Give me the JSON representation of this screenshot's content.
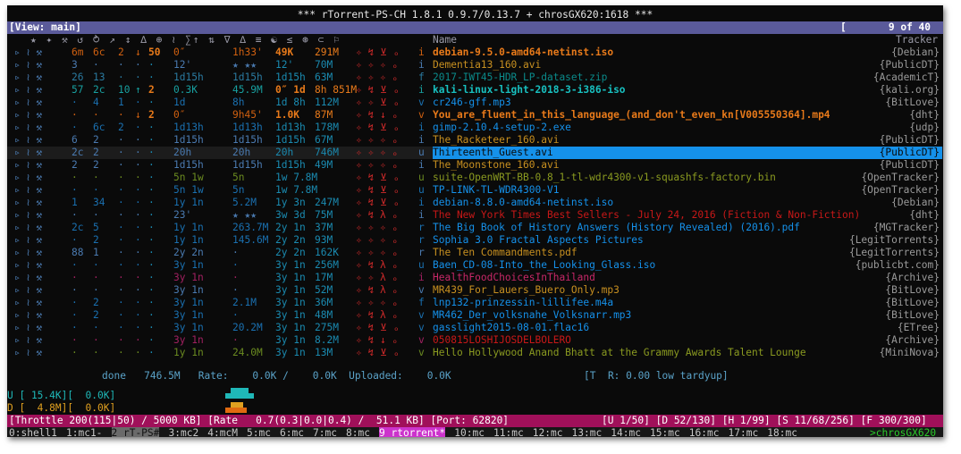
{
  "window_title": "*** rTorrent-PS-CH 1.8.1 0.9.7/0.13.7 + chrosGX620:1618 ***",
  "viewbar": {
    "left": "[View: main]",
    "right": "[       9 of 40   ]"
  },
  "columns": {
    "icons": "★ ✦ ⚒ ↺ ⥁ ↗ ↕ ∆ ⊕ ≀ ∑↑ ⇅ ∇ ∆ ≡ ☯ ≤ ⊛ ⊂ ⚐",
    "name": "Name",
    "tracker": "Tracker"
  },
  "rows": [
    {
      "flags": "▹ ≀ ⚒",
      "c1": "6m",
      "c2": "6c",
      "c3": "2",
      "c4": "↓",
      "c5": "50",
      "c6": "0″",
      "c7": "1h33'",
      "c8": "49K",
      "c9": "291M",
      "st": "✧ ↯ ⊻ ₒ",
      "k": "i",
      "name": "debian-9.5.0-amd64-netinst.iso",
      "tracker": "{Debian}",
      "ncolor": "#e87a1a",
      "bold": true,
      "rowcolor": "#d06010"
    },
    {
      "flags": "▹ ≀ ⚒",
      "c1": "3",
      "c2": "·",
      "c3": "·",
      "c4": "·",
      "c5": "·",
      "c6": "12'",
      "c7": "★ ★★",
      "c8": "12'",
      "c9": "70M",
      "st": "✧ ✧ ✧ ₒ",
      "k": "i",
      "name": "Dementia13_160.avi",
      "tracker": "{PublicDT}",
      "ncolor": "#c89020",
      "bold": false,
      "rowcolor": "#4a7ab0"
    },
    {
      "flags": "▹ ≀ ⚒",
      "c1": "26",
      "c2": "13",
      "c3": "·",
      "c4": "·",
      "c5": "·",
      "c6": "1d15h",
      "c7": "1d15h",
      "c8": "1d15h",
      "c9": "63M",
      "st": "✧ ✧ ✧ ₒ",
      "k": "f",
      "name": "2017-IWT45-HDR_LP-dataset.zip",
      "tracker": "{AcademicT}",
      "ncolor": "#0a8a8a",
      "bold": false,
      "rowcolor": "#2a7aa0"
    },
    {
      "flags": "▹ ≀ ⚒",
      "c1": "57",
      "c2": "2c",
      "c3": "10",
      "c4": "↑",
      "c5": "2",
      "c6": "0.3K",
      "c7": "45.9M",
      "c8": "0″ 1d",
      "c9": "8h 851M",
      "st": "✧ ↯ ⊻ ₒ",
      "k": "i",
      "name": "kali-linux-light-2018-3-i386-iso",
      "tracker": "{kali.org}",
      "ncolor": "#18c0c0",
      "bold": true,
      "rowcolor": "#18a0a0"
    },
    {
      "flags": "▹ ≀ ⚒",
      "c1": "·",
      "c2": "4",
      "c3": "1",
      "c4": "·",
      "c5": "·",
      "c6": "1d",
      "c7": "8h",
      "c8": "1d 8h",
      "c9": "112M",
      "st": "✧ ✧ ⊻ ₒ",
      "k": "v",
      "name": "cr246-gff.mp3",
      "tracker": "{BitLove}",
      "ncolor": "#1591ea",
      "bold": false,
      "rowcolor": "#1a70b0"
    },
    {
      "flags": "▹ ≀ ⚒",
      "c1": "·",
      "c2": "·",
      "c3": "·",
      "c4": "↓",
      "c5": "2",
      "c6": "0″",
      "c7": "9h45'",
      "c8": "1.0K",
      "c9": "87M",
      "st": "✧ ↯ ↓ ₒ",
      "k": "v",
      "name": "You_are_fluent_in_this_language_(and_don't_even_kn[V005550364].mp4",
      "tracker": "{dht}",
      "ncolor": "#e87a1a",
      "bold": true,
      "rowcolor": "#d06010"
    },
    {
      "flags": "▹ ≀ ⚒",
      "c1": "·",
      "c2": "6c",
      "c3": "2",
      "c4": "·",
      "c5": "·",
      "c6": "1d13h",
      "c7": "1d13h",
      "c8": "1d13h",
      "c9": "178M",
      "st": "✧ ↯ ⊻ ₒ",
      "k": "i",
      "name": "gimp-2.10.4-setup-2.exe",
      "tracker": "{udp}",
      "ncolor": "#1591ea",
      "bold": false,
      "rowcolor": "#1a70b0"
    },
    {
      "flags": "▹ ≀ ⚒",
      "c1": "6",
      "c2": "2",
      "c3": "·",
      "c4": "·",
      "c5": "·",
      "c6": "1d15h",
      "c7": "1d15h",
      "c8": "1d15h",
      "c9": "67M",
      "st": "✧ ✧ ✧ ₒ",
      "k": "i",
      "name": "The_Racketeer_160.avi",
      "tracker": "{PublicDT}",
      "ncolor": "#c89020",
      "bold": false,
      "rowcolor": "#4a7ab0"
    },
    {
      "flags": "▹ ≀ ⚒",
      "c1": "2c",
      "c2": "2",
      "c3": "·",
      "c4": "·",
      "c5": "·",
      "c6": "20h",
      "c7": "20h",
      "c8": "20h",
      "c9": "746M",
      "st": "✧ ✧ ✧ ₒ",
      "k": "u",
      "name": "Thirteenth_Guest.avi",
      "tracker": "{PublicDT}",
      "ncolor": "#0a0a0a",
      "bold": false,
      "rowcolor": "#4a7ab0",
      "selected": true
    },
    {
      "flags": "▹ ≀ ⚒",
      "c1": "2",
      "c2": "2",
      "c3": "·",
      "c4": "·",
      "c5": "·",
      "c6": "1d15h",
      "c7": "1d15h",
      "c8": "1d15h",
      "c9": "49M",
      "st": "✧ ✧ ✧ ₒ",
      "k": "i",
      "name": "The_Moonstone_160.avi",
      "tracker": "{PublicDT}",
      "ncolor": "#c89020",
      "bold": false,
      "rowcolor": "#4a7ab0"
    },
    {
      "flags": "▹ ≀ ⚒",
      "c1": "·",
      "c2": "·",
      "c3": "·",
      "c4": "·",
      "c5": "·",
      "c6": "5n 1w",
      "c7": "5n",
      "c8": "1w 7.8M",
      "c9": "",
      "st": "✧ ↯ ⊻ ₒ",
      "k": "u",
      "name": "suite-OpenWRT-BB-0.8_1-tl-wdr4300-v1-squashfs-factory.bin",
      "tracker": "{OpenTracker}",
      "ncolor": "#8a9a20",
      "bold": false,
      "rowcolor": "#6a8a20"
    },
    {
      "flags": "▹ ≀ ⚒",
      "c1": "·",
      "c2": "·",
      "c3": "·",
      "c4": "·",
      "c5": "·",
      "c6": "5n 1w",
      "c7": "5n",
      "c8": "1w 7.8M",
      "c9": "",
      "st": "✧ ↯ ⊻ ₒ",
      "k": "u",
      "name": "TP-LINK-TL-WDR4300-V1",
      "tracker": "{OpenTracker}",
      "ncolor": "#1591ea",
      "bold": false,
      "rowcolor": "#1a70b0"
    },
    {
      "flags": "▹ ≀ ⚒",
      "c1": "1",
      "c2": "34",
      "c3": "·",
      "c4": "·",
      "c5": "·",
      "c6": "1y 1n",
      "c7": "5.2M",
      "c8": "1y 3n",
      "c9": "247M",
      "st": "✧ ↯ ⊻ ₒ",
      "k": "i",
      "name": "debian-8.8.0-amd64-netinst.iso",
      "tracker": "{Debian}",
      "ncolor": "#1591ea",
      "bold": false,
      "rowcolor": "#1a70b0"
    },
    {
      "flags": "▹ ≀ ⚒",
      "c1": "·",
      "c2": "·",
      "c3": "·",
      "c4": "·",
      "c5": "·",
      "c6": "23'",
      "c7": "★ ★★",
      "c8": "3w 3d",
      "c9": "75M",
      "st": "✧ ↯ λ ₒ",
      "k": "i",
      "name": "The New York Times Best Sellers - July 24, 2016 (Fiction & Non-Fiction)",
      "tracker": "{dht}",
      "ncolor": "#c81818",
      "bold": false,
      "rowcolor": "#4a7ab0"
    },
    {
      "flags": "▹ ≀ ⚒",
      "c1": "2c",
      "c2": "5",
      "c3": "·",
      "c4": "·",
      "c5": "·",
      "c6": "1y 1n",
      "c7": "263.7M",
      "c8": "2y 1n",
      "c9": "37M",
      "st": "✧ ✧ ✧ ₒ",
      "k": "r",
      "name": "The Big Book of History Answers (History Revealed) (2016).pdf",
      "tracker": "{MGTracker}",
      "ncolor": "#1591ea",
      "bold": false,
      "rowcolor": "#1a70b0"
    },
    {
      "flags": "▹ ≀ ⚒",
      "c1": "·",
      "c2": "2",
      "c3": "·",
      "c4": "·",
      "c5": "·",
      "c6": "1y 1n",
      "c7": "145.6M",
      "c8": "2y 2n",
      "c9": "93M",
      "st": "✧ ✧ ✧ ₒ",
      "k": "r",
      "name": "Sophia 3.0 Fractal Aspects Pictures",
      "tracker": "{LegitTorrents}",
      "ncolor": "#1591ea",
      "bold": false,
      "rowcolor": "#1a70b0"
    },
    {
      "flags": "▹ ≀ ⚒",
      "c1": "88",
      "c2": "1",
      "c3": "·",
      "c4": "·",
      "c5": "·",
      "c6": "2y 2n",
      "c7": "·",
      "c8": "2y 2n",
      "c9": "162K",
      "st": "✧ ✧ ✧ ₒ",
      "k": "r",
      "name": "The Ten Commandments.pdf",
      "tracker": "{LegitTorrents}",
      "ncolor": "#c89020",
      "bold": false,
      "rowcolor": "#4a7ab0"
    },
    {
      "flags": "▹ ≀ ⚒",
      "c1": "·",
      "c2": "·",
      "c3": "·",
      "c4": "·",
      "c5": "·",
      "c6": "3y 1n",
      "c7": "·",
      "c8": "3y 1n",
      "c9": "256M",
      "st": "✧ ↯ λ ₒ",
      "k": "u",
      "name": "Baen_CD-08-Into_the_Looking_Glass.iso",
      "tracker": "{publicbt.com}",
      "ncolor": "#1591ea",
      "bold": false,
      "rowcolor": "#1a70b0"
    },
    {
      "flags": "▹ ≀ ⚒",
      "c1": "·",
      "c2": "·",
      "c3": "·",
      "c4": "·",
      "c5": "·",
      "c6": "3y 1n",
      "c7": "·",
      "c8": "3y 1n",
      "c9": "17M",
      "st": "✧ ✧ λ ₒ",
      "k": "i",
      "name": "HealthFoodChoicesInThailand",
      "tracker": "{Archive}",
      "ncolor": "#c82868",
      "bold": false,
      "rowcolor": "#a02060"
    },
    {
      "flags": "▹ ≀ ⚒",
      "c1": "·",
      "c2": "·",
      "c3": "·",
      "c4": "·",
      "c5": "·",
      "c6": "3y 1n",
      "c7": "·",
      "c8": "3y 1n",
      "c9": "52M",
      "st": "✧ ↯ λ ₒ",
      "k": "v",
      "name": "MR439_For_Lauers_Buero_Only.mp3",
      "tracker": "{BitLove}",
      "ncolor": "#c89020",
      "bold": false,
      "rowcolor": "#4a7ab0"
    },
    {
      "flags": "▹ ≀ ⚒",
      "c1": "·",
      "c2": "2",
      "c3": "·",
      "c4": "·",
      "c5": "·",
      "c6": "3y 1n",
      "c7": "2.1M",
      "c8": "3y 1n",
      "c9": "36M",
      "st": "✧ ✧ ✧ ₒ",
      "k": "f",
      "name": "lnp132-prinzessin-lillifee.m4a",
      "tracker": "{BitLove}",
      "ncolor": "#1591ea",
      "bold": false,
      "rowcolor": "#1a70b0"
    },
    {
      "flags": "▹ ≀ ⚒",
      "c1": "·",
      "c2": "2",
      "c3": "·",
      "c4": "·",
      "c5": "·",
      "c6": "3y 1n",
      "c7": "·",
      "c8": "3y 1n",
      "c9": "48M",
      "st": "✧ ↯ λ ₒ",
      "k": "v",
      "name": "MR462_Der_volksnahe_Volksnarr.mp3",
      "tracker": "{BitLove}",
      "ncolor": "#1591ea",
      "bold": false,
      "rowcolor": "#1a70b0"
    },
    {
      "flags": "▹ ≀ ⚒",
      "c1": "·",
      "c2": "·",
      "c3": "·",
      "c4": "·",
      "c5": "·",
      "c6": "3y 1n",
      "c7": "20.2M",
      "c8": "3y 1n",
      "c9": "275M",
      "st": "✧ ↯ ⊻ ₒ",
      "k": "v",
      "name": "gasslight2015-08-01.flac16",
      "tracker": "{ETree}",
      "ncolor": "#1591ea",
      "bold": false,
      "rowcolor": "#1a70b0"
    },
    {
      "flags": "▹ ≀ ⚒",
      "c1": "·",
      "c2": "·",
      "c3": "·",
      "c4": "·",
      "c5": "·",
      "c6": "3y 1n",
      "c7": "·",
      "c8": "3y 1n",
      "c9": "8.2M",
      "st": "✧ ↯ ↓ ₒ",
      "k": "v",
      "name": "050815LOSHIJOSDELBOLERO",
      "tracker": "{Archive}",
      "ncolor": "#c81818",
      "bold": false,
      "rowcolor": "#a02060"
    },
    {
      "flags": "▹ ≀ ⚒",
      "c1": "·",
      "c2": "·",
      "c3": "·",
      "c4": "·",
      "c5": "·",
      "c6": "1y 1n",
      "c7": "24.0M",
      "c8": "3y 1n",
      "c9": "13M",
      "st": "✧ ↯ ⊻ ₒ",
      "k": "v",
      "name": "Hello Hollywood Anand Bhatt at the Grammy Awards Talent Lounge",
      "tracker": "{MiniNova}",
      "ncolor": "#8a9a20",
      "bold": false,
      "rowcolor": "#6a8a20"
    }
  ],
  "footer": {
    "done": "done   746.5M   Rate:    0.0K /    0.0K  Uploaded:    0.0K",
    "tr": "[T  R: 0.00 low tardyup]",
    "up": "U [ 15.4K][  0.0K]",
    "dn": "D [  4.8M][  0.0K]"
  },
  "statusbar": {
    "left": "[Throttle 200(115|50) / 5000 KB] [Rate   0.7(0.3|0.0|0.4) /  51.1 KB] [Port: 62820]",
    "right": "[U 1/50] [D 52/130] [H 1/99] [S 11/68/256] [F 300/300]"
  },
  "tabs": [
    {
      "label": "0:shell1",
      "state": ""
    },
    {
      "label": "1:mc1-",
      "state": ""
    },
    {
      "label": "2 rT-PS#",
      "state": "prev"
    },
    {
      "label": "3:mc2",
      "state": ""
    },
    {
      "label": "4:mcM",
      "state": ""
    },
    {
      "label": "5:mc",
      "state": ""
    },
    {
      "label": "6:mc",
      "state": ""
    },
    {
      "label": "7:mc",
      "state": ""
    },
    {
      "label": "8:mc",
      "state": ""
    },
    {
      "label": "9 rtorrent*",
      "state": "active"
    },
    {
      "label": "10:mc",
      "state": ""
    },
    {
      "label": "11:mc",
      "state": ""
    },
    {
      "label": "12:mc",
      "state": ""
    },
    {
      "label": "13:mc",
      "state": ""
    },
    {
      "label": "14:mc",
      "state": ""
    },
    {
      "label": "15:mc",
      "state": ""
    },
    {
      "label": "16:mc",
      "state": ""
    },
    {
      "label": "17:mc",
      "state": ""
    },
    {
      "label": "18:mc",
      "state": ""
    }
  ],
  "host": ">chrosGX620",
  "colors": {
    "up": "#1fb8b8",
    "down": "#e0a020",
    "status_bg": "#a0105a",
    "highlight": "#1591ea"
  }
}
